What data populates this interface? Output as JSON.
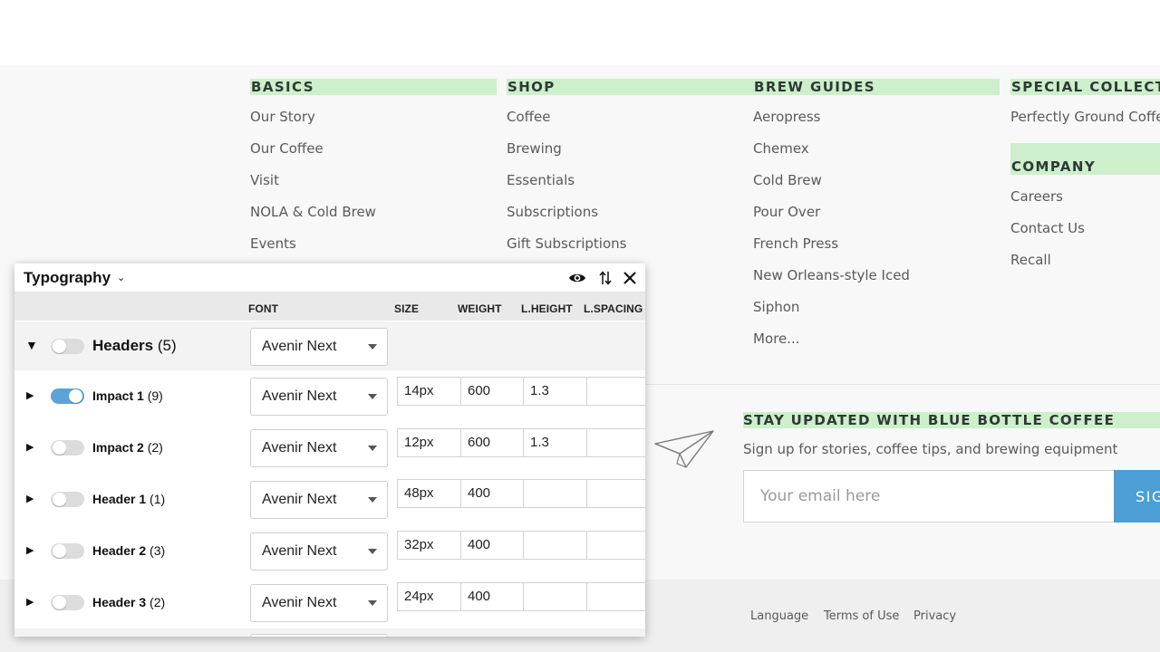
{
  "footer": {
    "columns": [
      {
        "heading": "BASICS",
        "links": [
          "Our Story",
          "Our Coffee",
          "Visit",
          "NOLA & Cold Brew",
          "Events"
        ]
      },
      {
        "heading": "SHOP",
        "links": [
          "Coffee",
          "Brewing",
          "Essentials",
          "Subscriptions",
          "Gift Subscriptions"
        ]
      },
      {
        "heading": "BREW GUIDES",
        "links": [
          "Aeropress",
          "Chemex",
          "Cold Brew",
          "Pour Over",
          "French Press",
          "New Orleans-style Iced",
          "Siphon",
          "More..."
        ]
      },
      {
        "heading": "SPECIAL COLLECT",
        "links": [
          "Perfectly Ground Coffe"
        ]
      },
      {
        "heading": "COMPANY",
        "links": [
          "Careers",
          "Contact Us",
          "Recall"
        ]
      }
    ],
    "newsletter": {
      "heading": "STAY UPDATED WITH BLUE BOTTLE COFFEE",
      "subtext": "Sign up for stories, coffee tips, and brewing equipment",
      "placeholder": "Your email here",
      "button_label": "SIG",
      "icon": "paper-plane-icon"
    },
    "legal": [
      "Language",
      "Terms of Use",
      "Privacy"
    ]
  },
  "panel": {
    "title": "Typography",
    "icons": [
      "chevron-down-icon",
      "eye-icon",
      "sort-arrows-icon",
      "close-icon"
    ],
    "columns": [
      "FONT",
      "SIZE",
      "WEIGHT",
      "L.HEIGHT",
      "L.SPACING"
    ],
    "group": {
      "name": "Headers",
      "count": "(5)",
      "font": "Avenir Next",
      "enabled": false
    },
    "rows": [
      {
        "name": "Impact 1",
        "count": "(9)",
        "font": "Avenir Next",
        "size": "14px",
        "weight": "600",
        "line_height": "1.3",
        "letter_spacing": "",
        "enabled": true
      },
      {
        "name": "Impact 2",
        "count": "(2)",
        "font": "Avenir Next",
        "size": "12px",
        "weight": "600",
        "line_height": "1.3",
        "letter_spacing": "",
        "enabled": false
      },
      {
        "name": "Header 1",
        "count": "(1)",
        "font": "Avenir Next",
        "size": "48px",
        "weight": "400",
        "line_height": "",
        "letter_spacing": "",
        "enabled": false
      },
      {
        "name": "Header 2",
        "count": "(3)",
        "font": "Avenir Next",
        "size": "32px",
        "weight": "400",
        "line_height": "",
        "letter_spacing": "",
        "enabled": false
      },
      {
        "name": "Header 3",
        "count": "(2)",
        "font": "Avenir Next",
        "size": "24px",
        "weight": "400",
        "line_height": "",
        "letter_spacing": "",
        "enabled": false
      }
    ]
  },
  "colors": {
    "accent_highlight": "#cdefcb",
    "toggle_on": "#5aa4d8",
    "signup_button": "#4b9fd5"
  }
}
